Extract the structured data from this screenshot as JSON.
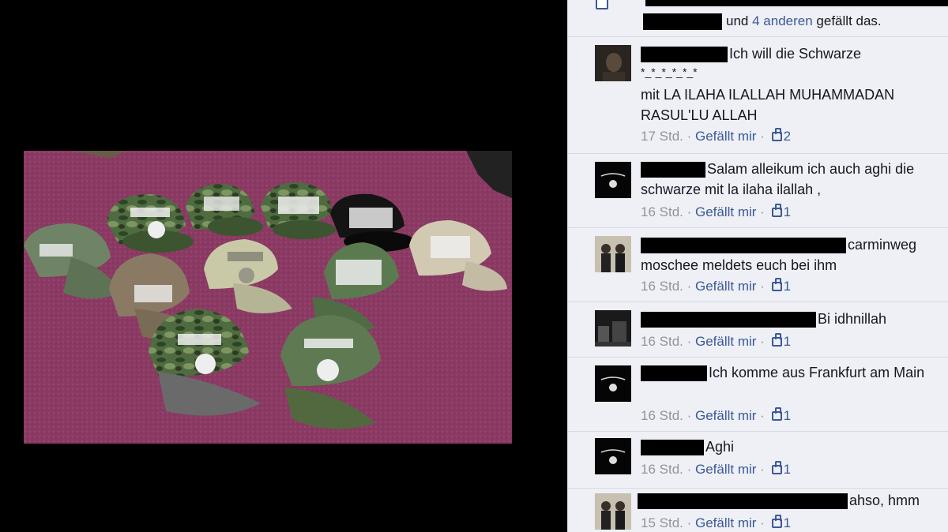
{
  "likes_bar": {
    "connector": "und",
    "others_link": "4 anderen",
    "suffix": "gefällt das."
  },
  "comments": [
    {
      "avatar": "portrait-avatar",
      "text_line1": "Ich will die Schwarze",
      "text_stars": "*_*_*_*_*_*",
      "text_rest": "mit LA ILAHA ILALLAH MUHAMMADAN RASUL'LU ALLAH",
      "time": "17 Std.",
      "like_label": "Gefällt mir",
      "like_count": "2"
    },
    {
      "avatar": "flag-avatar",
      "text": "Salam alleikum ich auch aghi die schwarze mit la ilaha ilallah ,",
      "time": "16 Std.",
      "like_label": "Gefällt mir",
      "like_count": "1"
    },
    {
      "avatar": "two-men-avatar",
      "text": "carminweg moschee meldets euch bei ihm",
      "time": "16 Std.",
      "like_label": "Gefällt mir",
      "like_count": "1"
    },
    {
      "avatar": "street-avatar",
      "text": "Bi idhnillah",
      "time": "16 Std.",
      "like_label": "Gefällt mir",
      "like_count": "1"
    },
    {
      "avatar": "flag-avatar",
      "text": "Ich komme aus Frankfurt am Main",
      "time": "16 Std.",
      "like_label": "Gefällt mir",
      "like_count": "1"
    },
    {
      "avatar": "flag-avatar",
      "text": "Aghi",
      "time": "16 Std.",
      "like_label": "Gefällt mir",
      "like_count": "1"
    },
    {
      "avatar": "two-men-avatar",
      "text": "ahso, hmm",
      "time": "15 Std.",
      "like_label": "Gefällt mir",
      "like_count": "1"
    }
  ],
  "colors": {
    "link": "#3b5998",
    "meta": "#90949c",
    "panel": "#eef0f5",
    "carpet": "#8a3a63"
  }
}
